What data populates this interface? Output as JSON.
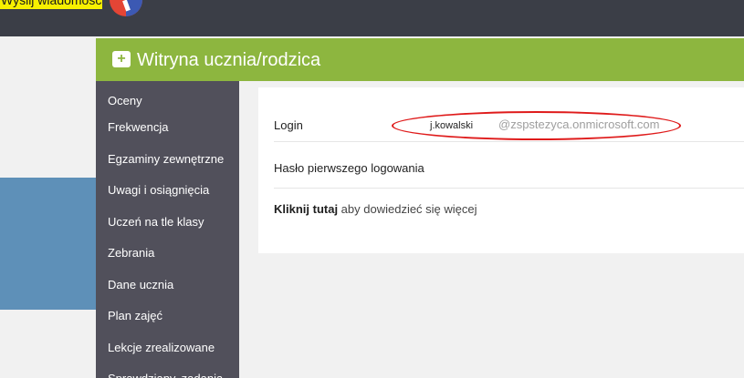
{
  "highlight_text": "Wyślij wiadomość",
  "header": {
    "title": "Witryna ucznia/rodzica",
    "title_icon": "plus-chat-icon",
    "title_icon_glyph": "+"
  },
  "sidebar": {
    "items": [
      "Oceny",
      "Frekwencja",
      "Egzaminy zewnętrzne",
      "Uwagi i osiągnięcia",
      "Uczeń na tle klasy",
      "Zebrania",
      "Dane ucznia",
      "Plan zajęć",
      "Lekcje zrealizowane",
      "Sprawdziany, zadania"
    ]
  },
  "login_row": {
    "label": "Login",
    "user": "j.kowalski",
    "domain": "@zspstezyca.onmicrosoft.com"
  },
  "password_row": {
    "label": "Hasło pierwszego logowania"
  },
  "info_row": {
    "link": "Kliknij tutaj",
    "text": " aby dowiedzieć się więcej"
  },
  "colors": {
    "top_bar": "#3b3e47",
    "header_green": "#8db63f",
    "sidebar": "#51505b",
    "annotation_red": "#df1b1b",
    "highlight_yellow": "#f7f000"
  }
}
